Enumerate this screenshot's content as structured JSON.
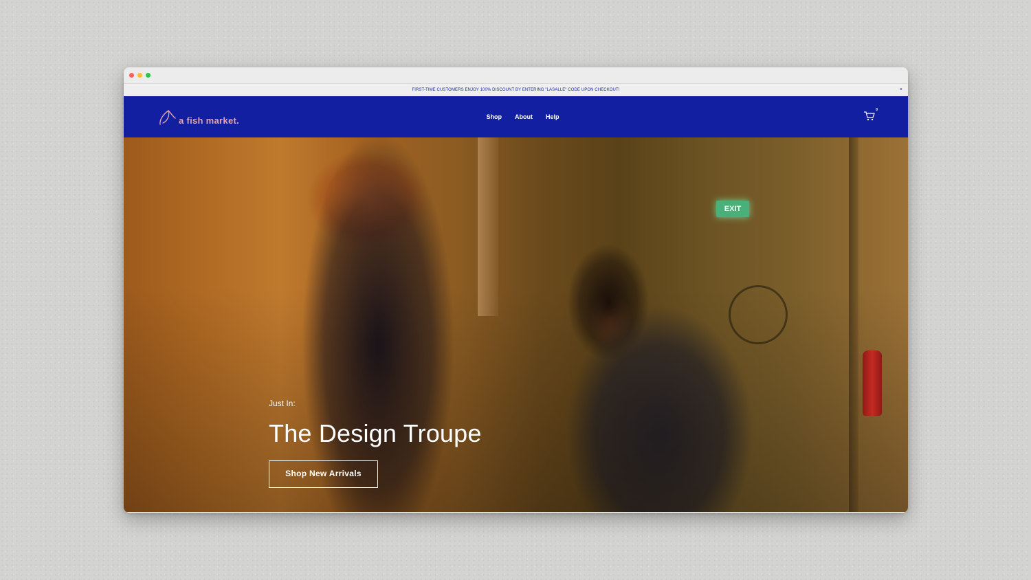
{
  "colors": {
    "nav_background": "#111fa0",
    "logo_accent": "#e6a4ab",
    "announcement_text": "#111fa0",
    "window_red": "#ff5f57",
    "window_yellow": "#febc2e",
    "window_green": "#28c840"
  },
  "announcement": {
    "text": "FIRST-TIME CUSTOMERS ENJOY 100% DISCOUNT BY ENTERING \"LASALLE\" CODE UPON CHECKOUT!",
    "close_label": "×"
  },
  "header": {
    "logo_icon": "fish-logo-icon",
    "logo_text": "a fish market.",
    "nav": [
      {
        "label": "Shop"
      },
      {
        "label": "About"
      },
      {
        "label": "Help"
      }
    ],
    "cart_icon": "shopping-cart-icon",
    "cart_count": "0"
  },
  "hero": {
    "eyebrow": "Just In:",
    "title": "The Design Troupe",
    "button_label": "Shop New Arrivals",
    "exit_sign": "EXIT"
  }
}
